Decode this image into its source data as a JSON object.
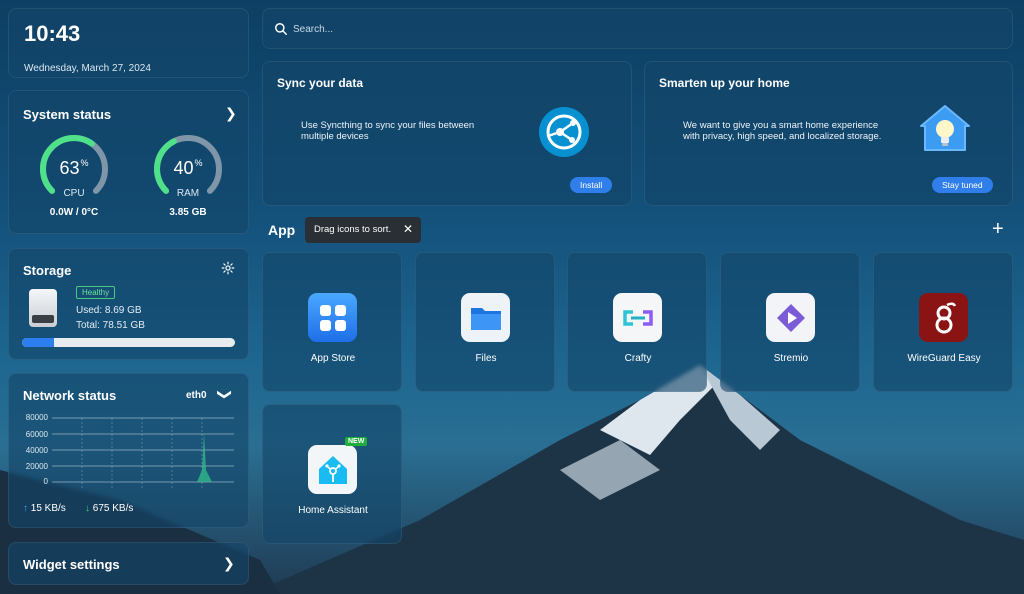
{
  "clock": {
    "time": "10:43",
    "date": "Wednesday, March 27, 2024"
  },
  "system": {
    "title": "System status",
    "cpu": {
      "value": "63",
      "unit": "%",
      "label": "CPU",
      "sub": "0.0W / 0°C",
      "percent": 63
    },
    "ram": {
      "value": "40",
      "unit": "%",
      "label": "RAM",
      "sub": "3.85 GB",
      "percent": 40
    }
  },
  "storage": {
    "title": "Storage",
    "health": "Healthy",
    "used": "Used: 8.69 GB",
    "total": "Total: 78.51 GB",
    "used_fraction": 0.15
  },
  "network": {
    "title": "Network status",
    "interface": "eth0",
    "y_ticks": [
      "80000",
      "60000",
      "40000",
      "20000",
      "0"
    ],
    "upload": "15 KB/s",
    "download": "675 KB/s"
  },
  "widget": {
    "label": "Widget settings"
  },
  "search": {
    "placeholder": "Search..."
  },
  "promos": [
    {
      "title": "Sync your data",
      "desc1": "Use Syncthing to sync your files between",
      "desc2": "multiple devices",
      "button": "Install",
      "icon": "syncthing-icon"
    },
    {
      "title": "Smarten up your home",
      "desc1": "We want to give you a smart home experience",
      "desc2": "with privacy, high speed, and localized storage.",
      "button": "Stay tuned",
      "icon": "smart-home-icon"
    }
  ],
  "apps_section": {
    "title": "App",
    "tooltip": "Drag icons to sort."
  },
  "apps": [
    {
      "name": "App Store",
      "icon": "app-store-icon"
    },
    {
      "name": "Files",
      "icon": "files-icon"
    },
    {
      "name": "Crafty",
      "icon": "crafty-icon"
    },
    {
      "name": "Stremio",
      "icon": "stremio-icon"
    },
    {
      "name": "WireGuard Easy",
      "icon": "wireguard-icon"
    },
    {
      "name": "Home Assistant",
      "icon": "home-assistant-icon",
      "badge": "NEW"
    }
  ],
  "colors": {
    "accent": "#2f7eea",
    "gauge_green": "#4fe08a",
    "healthy": "#4cc77e",
    "new_badge": "#1fae3b"
  }
}
